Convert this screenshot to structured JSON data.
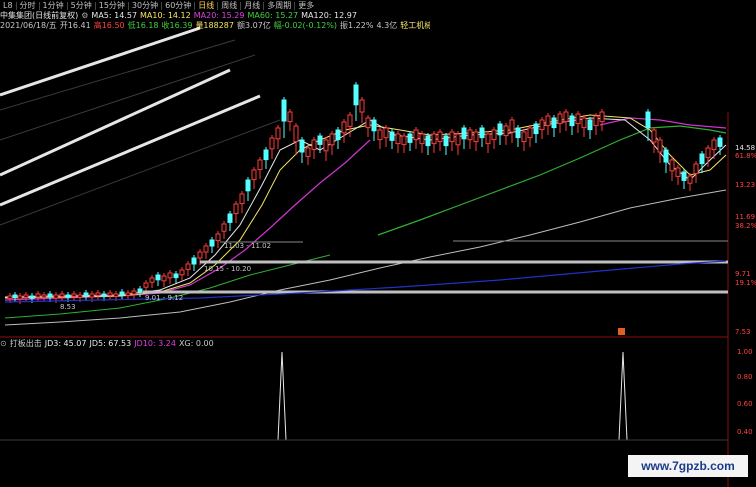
{
  "toolbar": {
    "tabs": [
      "L8",
      "分时",
      "1分钟",
      "5分钟",
      "15分钟",
      "30分钟",
      "60分钟",
      "日线",
      "周线",
      "月线",
      "多周期",
      "更多"
    ],
    "active_index": 7
  },
  "ma_bar": {
    "name": "中集集团(日线前复权)",
    "items": [
      {
        "label": "MA5: 14.57",
        "color": "#e8e8e8"
      },
      {
        "label": "MA10: 14.12",
        "color": "#f5e663"
      },
      {
        "label": "MA20: 15.29",
        "color": "#e040e0"
      },
      {
        "label": "MA60: 15.27",
        "color": "#40d040"
      },
      {
        "label": "MA120: 12.97",
        "color": "#e8e8e8"
      }
    ]
  },
  "quote_bar": {
    "items": [
      {
        "label": "2021/06/18/五",
        "color": "#c8c8c8"
      },
      {
        "label": "开16.41",
        "color": "#c8c8c8"
      },
      {
        "label": "高16.50",
        "color": "#ff4040"
      },
      {
        "label": "低16.18",
        "color": "#40d040"
      },
      {
        "label": "收16.39",
        "color": "#40d040"
      },
      {
        "label": "量188287",
        "color": "#f5e663"
      },
      {
        "label": "额3.07亿",
        "color": "#c8c8c8"
      },
      {
        "label": "幅-0.02(-0.12%)",
        "color": "#40d040"
      },
      {
        "label": "振1.22%",
        "color": "#c8c8c8"
      },
      {
        "label": "4.3亿",
        "color": "#c8c8c8"
      },
      {
        "label": "轻工机械",
        "color": "#f5e663"
      }
    ]
  },
  "price_axis": {
    "labels": [
      "14.58",
      "61.8%",
      "13.23",
      "11.69",
      "38.2%",
      "9.71",
      "19.1%",
      "7.53"
    ],
    "colors": [
      "#e8e8e8",
      "#ff4040",
      "#ff4040",
      "#ff4040",
      "#ff4040",
      "#ff4040",
      "#ff4040",
      "#ff4040"
    ]
  },
  "price_annotations": [
    {
      "label": "11.03 - 11.02"
    },
    {
      "label": "10.15 - 10.20"
    },
    {
      "label": "9.01 - 9.12"
    },
    {
      "label": "8.53"
    }
  ],
  "indicator_bar": {
    "items": [
      {
        "label": "打板出击",
        "color": "#c8c8c8"
      },
      {
        "label": "JD3: 45.07",
        "color": "#e8e8e8"
      },
      {
        "label": "JD5: 67.53",
        "color": "#e8e8e8"
      },
      {
        "label": "JD10: 3.24",
        "color": "#e040e0"
      },
      {
        "label": "XG: 0.00",
        "color": "#c8c8c8"
      }
    ]
  },
  "indicator_axis": {
    "labels": [
      "1.00",
      "0.80",
      "0.60",
      "0.40"
    ]
  },
  "watermark": "www.7gpzb.com"
}
